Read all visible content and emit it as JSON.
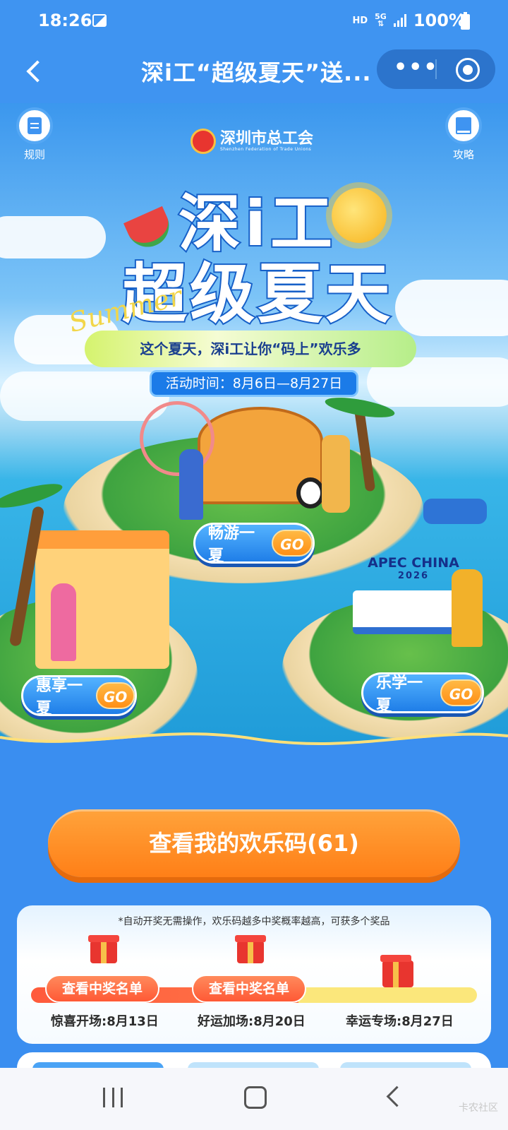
{
  "status_bar": {
    "time": "18:26",
    "hd": "HD",
    "network": "5G",
    "battery": "100%"
  },
  "nav": {
    "title": "深i工“超级夏天”送...",
    "more_icon": "more-dots-icon",
    "close_icon": "target-icon"
  },
  "hero": {
    "rules_label": "规则",
    "guide_label": "攻略",
    "logo_cn": "深圳市总工会",
    "logo_en": "Shenzhen Federation of Trade Unions",
    "title_line1": "深i工",
    "title_line2": "超级夏天",
    "script_word": "Summer",
    "slogan": "这个夏天，深i工让你“码上”欢乐多",
    "period": "活动时间：8月6日—8月27日",
    "apec_line1": "APEC CHINA",
    "apec_line2": "2026",
    "go_buttons": [
      {
        "label": "畅游一夏",
        "go": "GO"
      },
      {
        "label": "惠享一夏",
        "go": "GO"
      },
      {
        "label": "乐学一夏",
        "go": "GO"
      }
    ]
  },
  "main_button": "查看我的欢乐码(61)",
  "draw_card": {
    "note": "*自动开奖无需操作，欢乐码越多中奖概率越高，可获多个奖品",
    "progress": 0.6,
    "stages": [
      {
        "button": "查看中奖名单",
        "label": "惊喜开场:8月13日"
      },
      {
        "button": "查看中奖名单",
        "label": "好运加场:8月20日"
      },
      {
        "button": "",
        "label": "幸运专场:8月27日"
      }
    ]
  },
  "watermark": "卡农社区",
  "colors": {
    "primary_blue": "#3f94f1",
    "orange": "#ff7f17",
    "accent_red": "#ff5935"
  }
}
